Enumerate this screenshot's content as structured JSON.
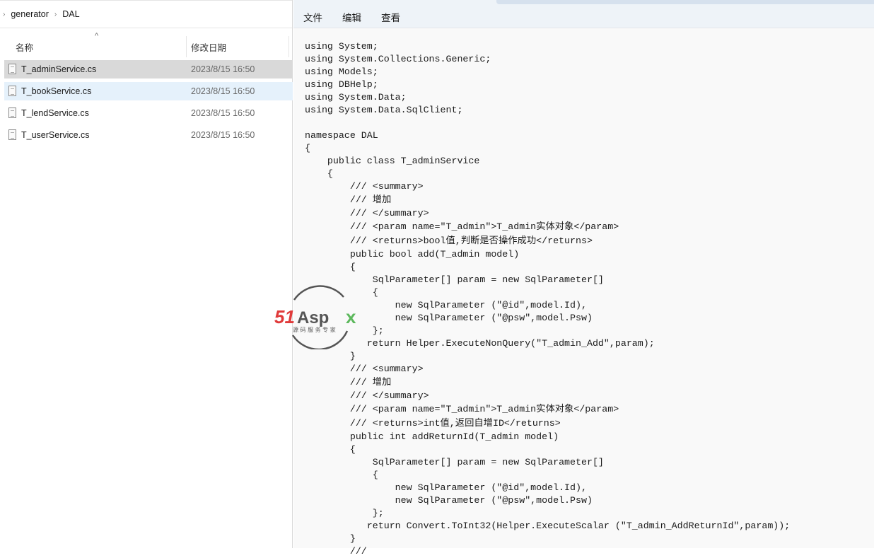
{
  "explorer": {
    "breadcrumb": [
      "generator",
      "DAL"
    ],
    "columns": {
      "name": "名称",
      "date": "修改日期"
    },
    "files": [
      {
        "name": "T_adminService.cs",
        "date": "2023/8/15 16:50"
      },
      {
        "name": "T_bookService.cs",
        "date": "2023/8/15 16:50"
      },
      {
        "name": "T_lendService.cs",
        "date": "2023/8/15 16:50"
      },
      {
        "name": "T_userService.cs",
        "date": "2023/8/15 16:50"
      }
    ]
  },
  "notepad": {
    "menu": [
      "文件",
      "编辑",
      "查看"
    ],
    "lines": [
      "using System;",
      "using System.Collections.Generic;",
      "using Models;",
      "using DBHelp;",
      "using System.Data;",
      "using System.Data.SqlClient;",
      "",
      "namespace DAL",
      "{",
      "    public class T_adminService",
      "    {",
      "        /// <summary>",
      "        /// 增加",
      "        /// </summary>",
      "        /// <param name=\"T_admin\">T_admin实体对象</param>",
      "        /// <returns>bool值,判断是否操作成功</returns>",
      "        public bool add(T_admin model)",
      "        {",
      "            SqlParameter[] param = new SqlParameter[]",
      "            {",
      "                new SqlParameter (\"@id\",model.Id),",
      "                new SqlParameter (\"@psw\",model.Psw)",
      "            };",
      "           return Helper.ExecuteNonQuery(\"T_admin_Add\",param);",
      "        }",
      "        /// <summary>",
      "        /// 增加",
      "        /// </summary>",
      "        /// <param name=\"T_admin\">T_admin实体对象</param>",
      "        /// <returns>int值,返回自增ID</returns>",
      "        public int addReturnId(T_admin model)",
      "        {",
      "            SqlParameter[] param = new SqlParameter[]",
      "            {",
      "                new SqlParameter (\"@id\",model.Id),",
      "                new SqlParameter (\"@psw\",model.Psw)",
      "            };",
      "           return Convert.ToInt32(Helper.ExecuteScalar (\"T_admin_AddReturnId\",param));",
      "        }",
      "        ///"
    ]
  },
  "watermark": {
    "brand": "51Aspx",
    "tagline": "源码服务专家"
  }
}
